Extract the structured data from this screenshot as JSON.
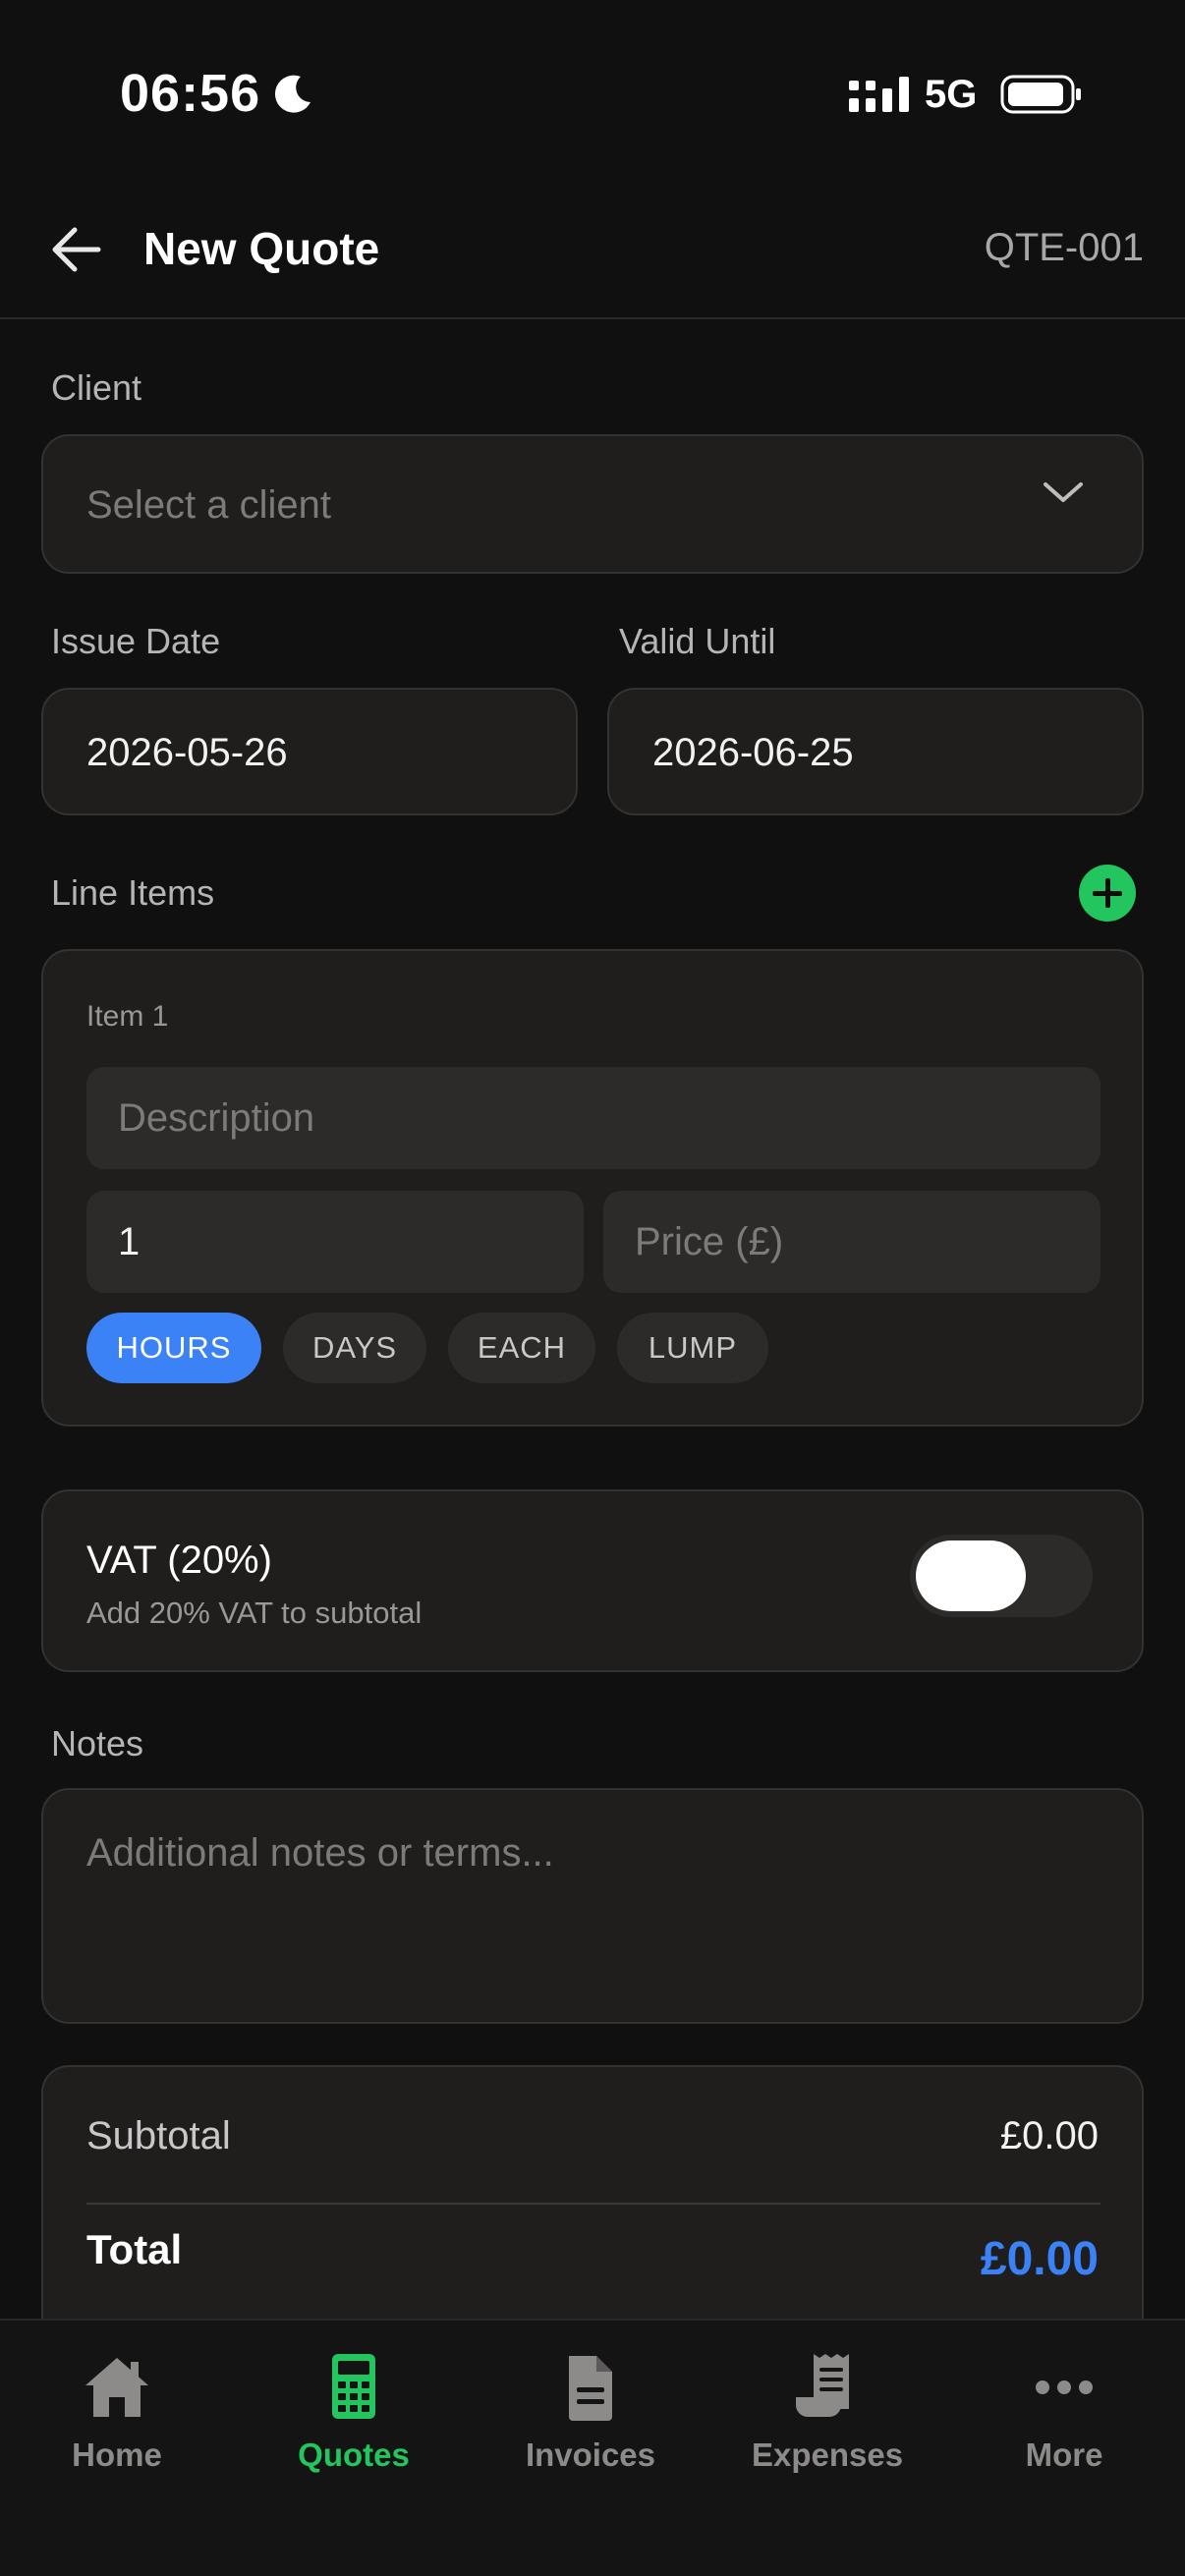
{
  "status_bar": {
    "time": "06:56",
    "network": "5G"
  },
  "header": {
    "title": "New Quote",
    "quote_number": "QTE-001"
  },
  "client": {
    "label": "Client",
    "placeholder": "Select a client"
  },
  "dates": {
    "issue_label": "Issue Date",
    "issue_value": "2026-05-26",
    "valid_label": "Valid Until",
    "valid_value": "2026-06-25"
  },
  "line_items": {
    "label": "Line Items",
    "items": [
      {
        "title": "Item 1",
        "description_placeholder": "Description",
        "quantity": "1",
        "price_placeholder": "Price (£)",
        "units": [
          "HOURS",
          "DAYS",
          "EACH",
          "LUMP"
        ],
        "selected_unit": "HOURS"
      }
    ]
  },
  "vat": {
    "title": "VAT (20%)",
    "subtitle": "Add 20% VAT to subtotal",
    "enabled": false
  },
  "notes": {
    "label": "Notes",
    "placeholder": "Additional notes or terms..."
  },
  "totals": {
    "subtotal_label": "Subtotal",
    "subtotal_value": "£0.00",
    "total_label": "Total",
    "total_value": "£0.00"
  },
  "tabs": [
    {
      "label": "Home",
      "icon": "home-icon"
    },
    {
      "label": "Quotes",
      "icon": "calculator-icon",
      "active": true
    },
    {
      "label": "Invoices",
      "icon": "document-icon"
    },
    {
      "label": "Expenses",
      "icon": "receipt-icon"
    },
    {
      "label": "More",
      "icon": "more-icon"
    }
  ],
  "colors": {
    "accent_green": "#22c55e",
    "accent_blue": "#3b82f6",
    "background": "#101010"
  }
}
